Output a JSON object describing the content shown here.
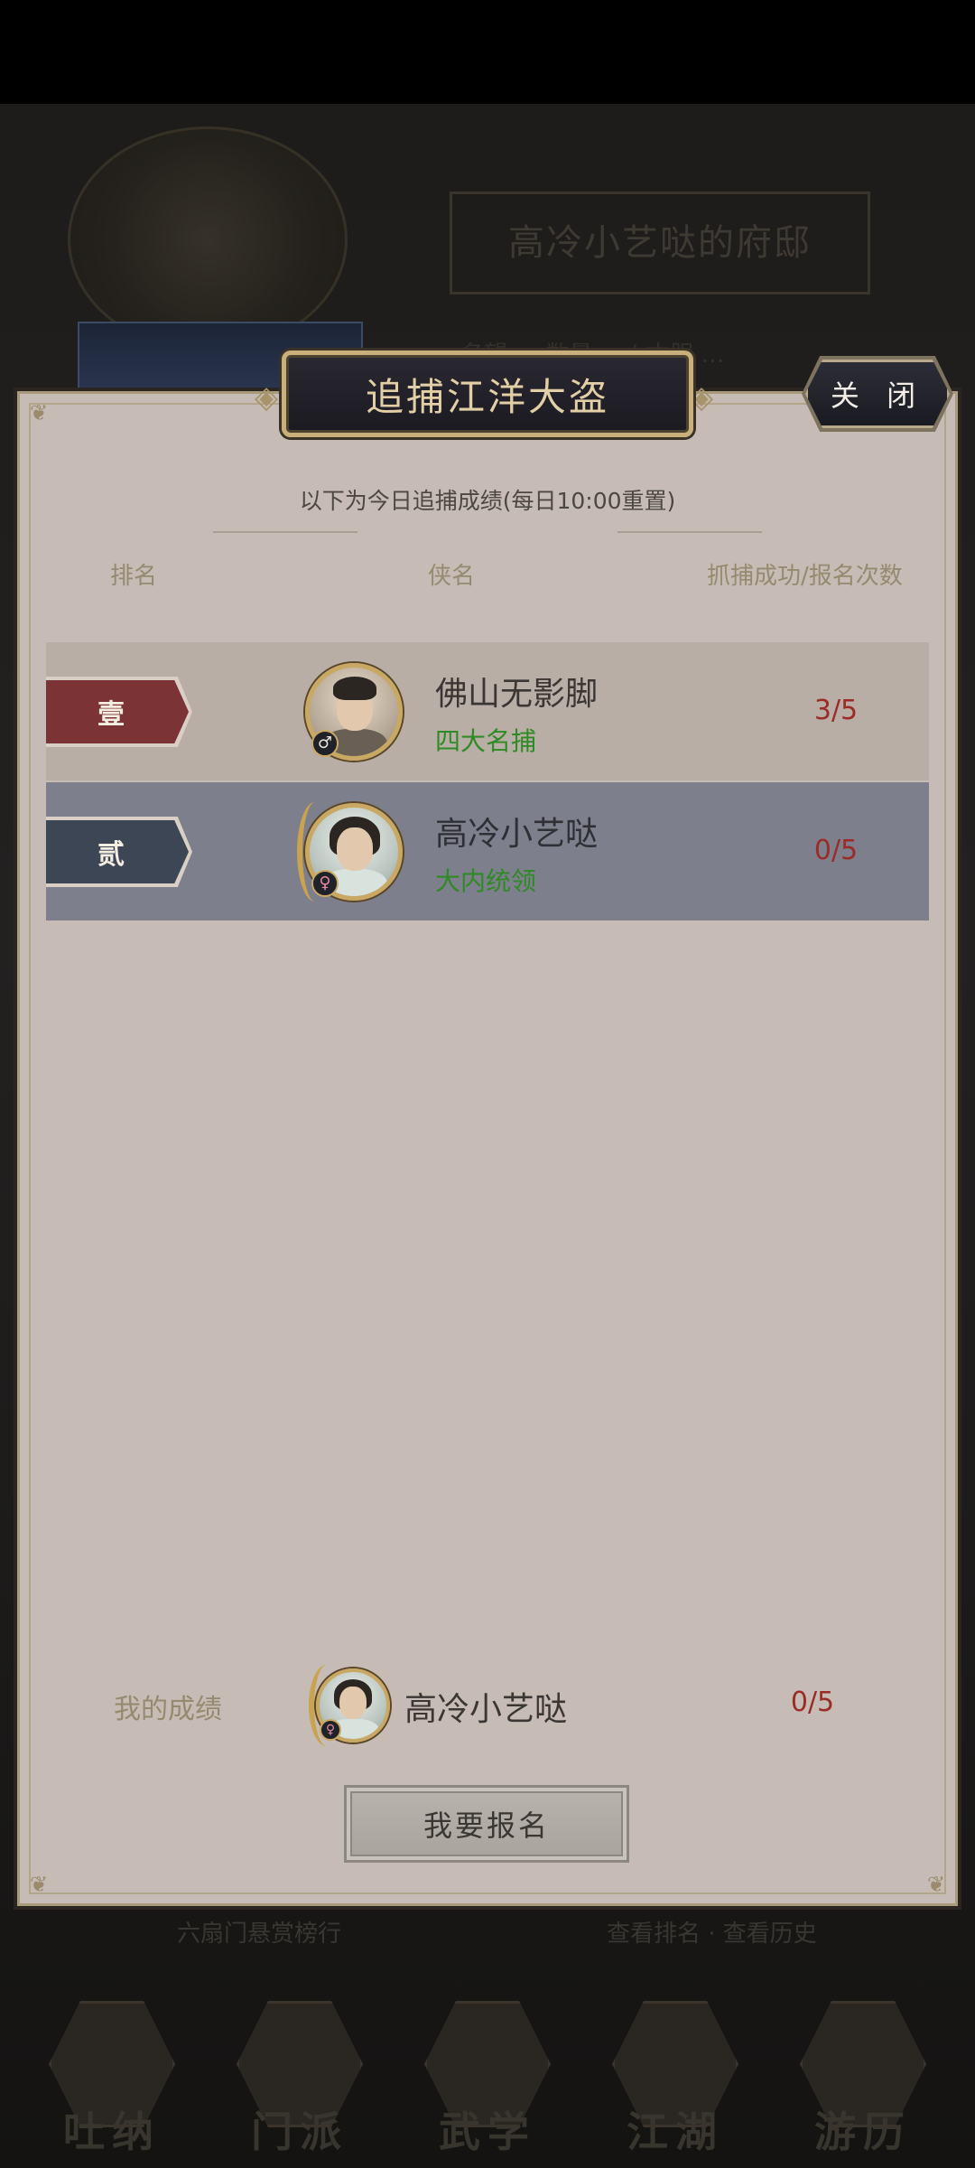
{
  "background": {
    "mansion_title": "高冷小艺哒的府邸",
    "stats_text": "名望 …   数量 …  |  本服 …",
    "footer_left": "六扇门悬赏榜行",
    "footer_right": "查看排名 · 查看历史",
    "nav": [
      "吐纳",
      "门派",
      "武学",
      "江湖",
      "游历"
    ]
  },
  "dialog": {
    "title": "追捕江洋大盗",
    "close_label": "关 闭",
    "subtitle": "以下为今日追捕成绩(每日10:00重置)",
    "columns": {
      "rank": "排名",
      "hero": "侠名",
      "score": "抓捕成功/报名次数"
    },
    "rows": [
      {
        "rank": "壹",
        "name": "佛山无影脚",
        "title": "四大名捕",
        "score": "3/5",
        "gender": "♂",
        "rank_color": "#7c3336"
      },
      {
        "rank": "贰",
        "name": "高冷小艺哒",
        "title": "大内统领",
        "score": "0/5",
        "gender": "♀",
        "rank_color": "#3c4654"
      }
    ],
    "my_result": {
      "label": "我的成绩",
      "name": "高冷小艺哒",
      "score": "0/5",
      "gender": "♀"
    },
    "signup_label": "我要报名"
  },
  "colors": {
    "panel_bg": "#c6bcb5",
    "row1_bg": "#b9aea5",
    "row2_bg": "#7d7f8c",
    "title_gold": "#e3cfa6",
    "score_red": "#9b2b27",
    "title_green": "#2e8a24"
  },
  "icons": {
    "male": "male-gender-icon",
    "female": "female-gender-icon"
  }
}
